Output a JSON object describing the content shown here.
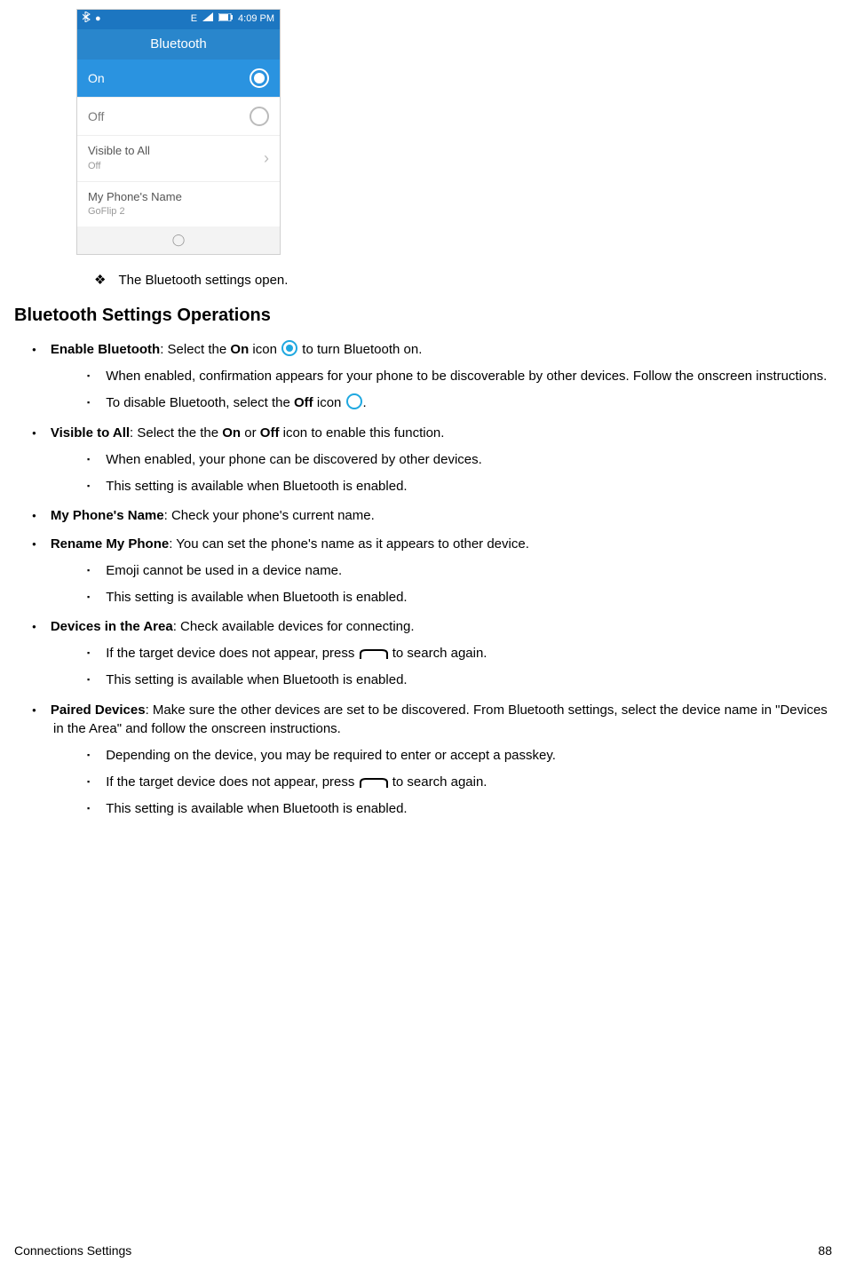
{
  "phone": {
    "status_time": "4:09 PM",
    "status_net": "E",
    "title": "Bluetooth",
    "on_label": "On",
    "off_label": "Off",
    "visible_label": "Visible to All",
    "visible_value": "Off",
    "name_label": "My Phone's Name",
    "name_value": "GoFlip 2",
    "nav_symbol": "◯"
  },
  "diamond_line": "The Bluetooth settings open.",
  "section_heading": "Bluetooth Settings Operations",
  "items": [
    {
      "title": "Enable Bluetooth",
      "after_title": ": Select the ",
      "bold_inline": "On",
      "after_bold": " icon ",
      "icon": "radio-on",
      "tail": " to turn Bluetooth on.",
      "subs": [
        {
          "text": "When enabled, confirmation appears for your phone to be discoverable by other devices. Follow the onscreen instructions."
        },
        {
          "pre": "To disable Bluetooth, select the ",
          "bold": "Off",
          "mid": " icon ",
          "icon": "radio-off",
          "post": "."
        }
      ]
    },
    {
      "title": "Visible to All",
      "after_title": ": Select the the ",
      "bold_inline": "On",
      "mid2": " or ",
      "bold_inline2": "Off",
      "tail": " icon to enable this function.",
      "subs": [
        {
          "text": "When enabled, your phone can be discovered by other devices."
        },
        {
          "text": "This setting is available when Bluetooth is enabled."
        }
      ]
    },
    {
      "title": "My Phone's Name",
      "tail_plain": ": Check your phone's current name."
    },
    {
      "title": "Rename My Phone",
      "tail_plain": ": You can set the phone's name as it appears to other device.",
      "subs": [
        {
          "text": "Emoji cannot be used in a device name."
        },
        {
          "text": "This setting is available when Bluetooth is enabled."
        }
      ]
    },
    {
      "title": "Devices in the Area",
      "tail_plain": ": Check available devices for connecting.",
      "subs": [
        {
          "pre": "If the target device does not appear, press ",
          "icon": "softkey",
          "post": " to search again."
        },
        {
          "text": "This setting is available when Bluetooth is enabled."
        }
      ]
    },
    {
      "title": "Paired Devices",
      "tail_plain": ": Make sure the other devices are set to be discovered. From Bluetooth settings, select the device name in \"Devices in the Area\" and follow the onscreen instructions.",
      "subs": [
        {
          "text": "Depending on the device, you may be required to enter or accept a passkey."
        },
        {
          "pre": "If the target device does not appear, press ",
          "icon": "softkey",
          "post": " to search again."
        },
        {
          "text": "This setting is available when Bluetooth is enabled."
        }
      ]
    }
  ],
  "footer_left": "Connections Settings",
  "footer_right": "88"
}
